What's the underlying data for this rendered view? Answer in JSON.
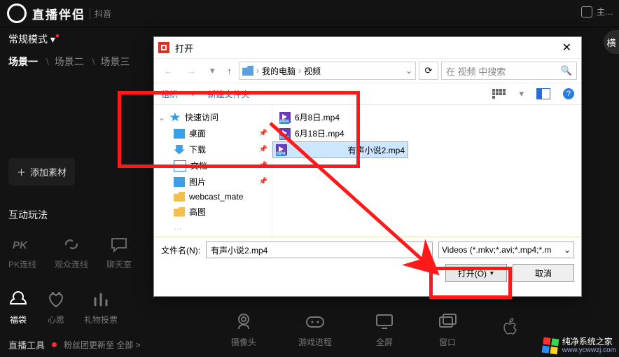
{
  "app": {
    "brand": "直播伴侣",
    "brand_sub": "抖音",
    "top_right_label": "主…",
    "right_pill": "横"
  },
  "left": {
    "mode": "常规模式",
    "tabs": {
      "scene1": "场景一",
      "scene2": "场景二",
      "scene3": "场景三"
    },
    "add_material": "添加素材",
    "interactive_title": "互动玩法",
    "interactive": [
      {
        "label": "PK连线",
        "key": "pk"
      },
      {
        "label": "观众连线",
        "key": "aud"
      },
      {
        "label": "聊天室",
        "key": "chat"
      }
    ],
    "tools": [
      {
        "label": "福袋",
        "key": "bag",
        "active": true
      },
      {
        "label": "心愿",
        "key": "wish",
        "active": false
      },
      {
        "label": "礼物投票",
        "key": "gift",
        "active": false
      }
    ],
    "bottom": {
      "title": "直播工具",
      "news": "粉丝团更新至 全部 >"
    }
  },
  "sources": [
    {
      "label": "摄像头",
      "key": "camera"
    },
    {
      "label": "游戏进程",
      "key": "game"
    },
    {
      "label": "全屏",
      "key": "fullscreen"
    },
    {
      "label": "窗口",
      "key": "window"
    },
    {
      "label": "",
      "key": "apple"
    }
  ],
  "dialog": {
    "title": "打开",
    "crumb": {
      "root": "我的电脑",
      "folder": "视频"
    },
    "search_placeholder": "在 视频 中搜索",
    "toolbar": {
      "organize": "组织",
      "new_folder": "新建文件夹"
    },
    "tree": {
      "quick": "快速访问",
      "desktop": "桌面",
      "downloads": "下载",
      "documents": "文档",
      "pictures": "图片",
      "webcast": "webcast_mate",
      "gaotu": "高图"
    },
    "files": [
      {
        "name": "6月8日.mp4",
        "selected": false
      },
      {
        "name": "6月18日.mp4",
        "selected": false
      },
      {
        "name": "有声小说2.mp4",
        "selected": true
      }
    ],
    "filename_label": "文件名(N):",
    "filename_value": "有声小说2.mp4",
    "filter": "Videos (*.mkv;*.avi;*.mp4;*.m",
    "open_btn": "打开(O)",
    "cancel_btn": "取消"
  },
  "watermark": {
    "name": "纯净系统之家",
    "url": "www.ycwwzj.com"
  }
}
